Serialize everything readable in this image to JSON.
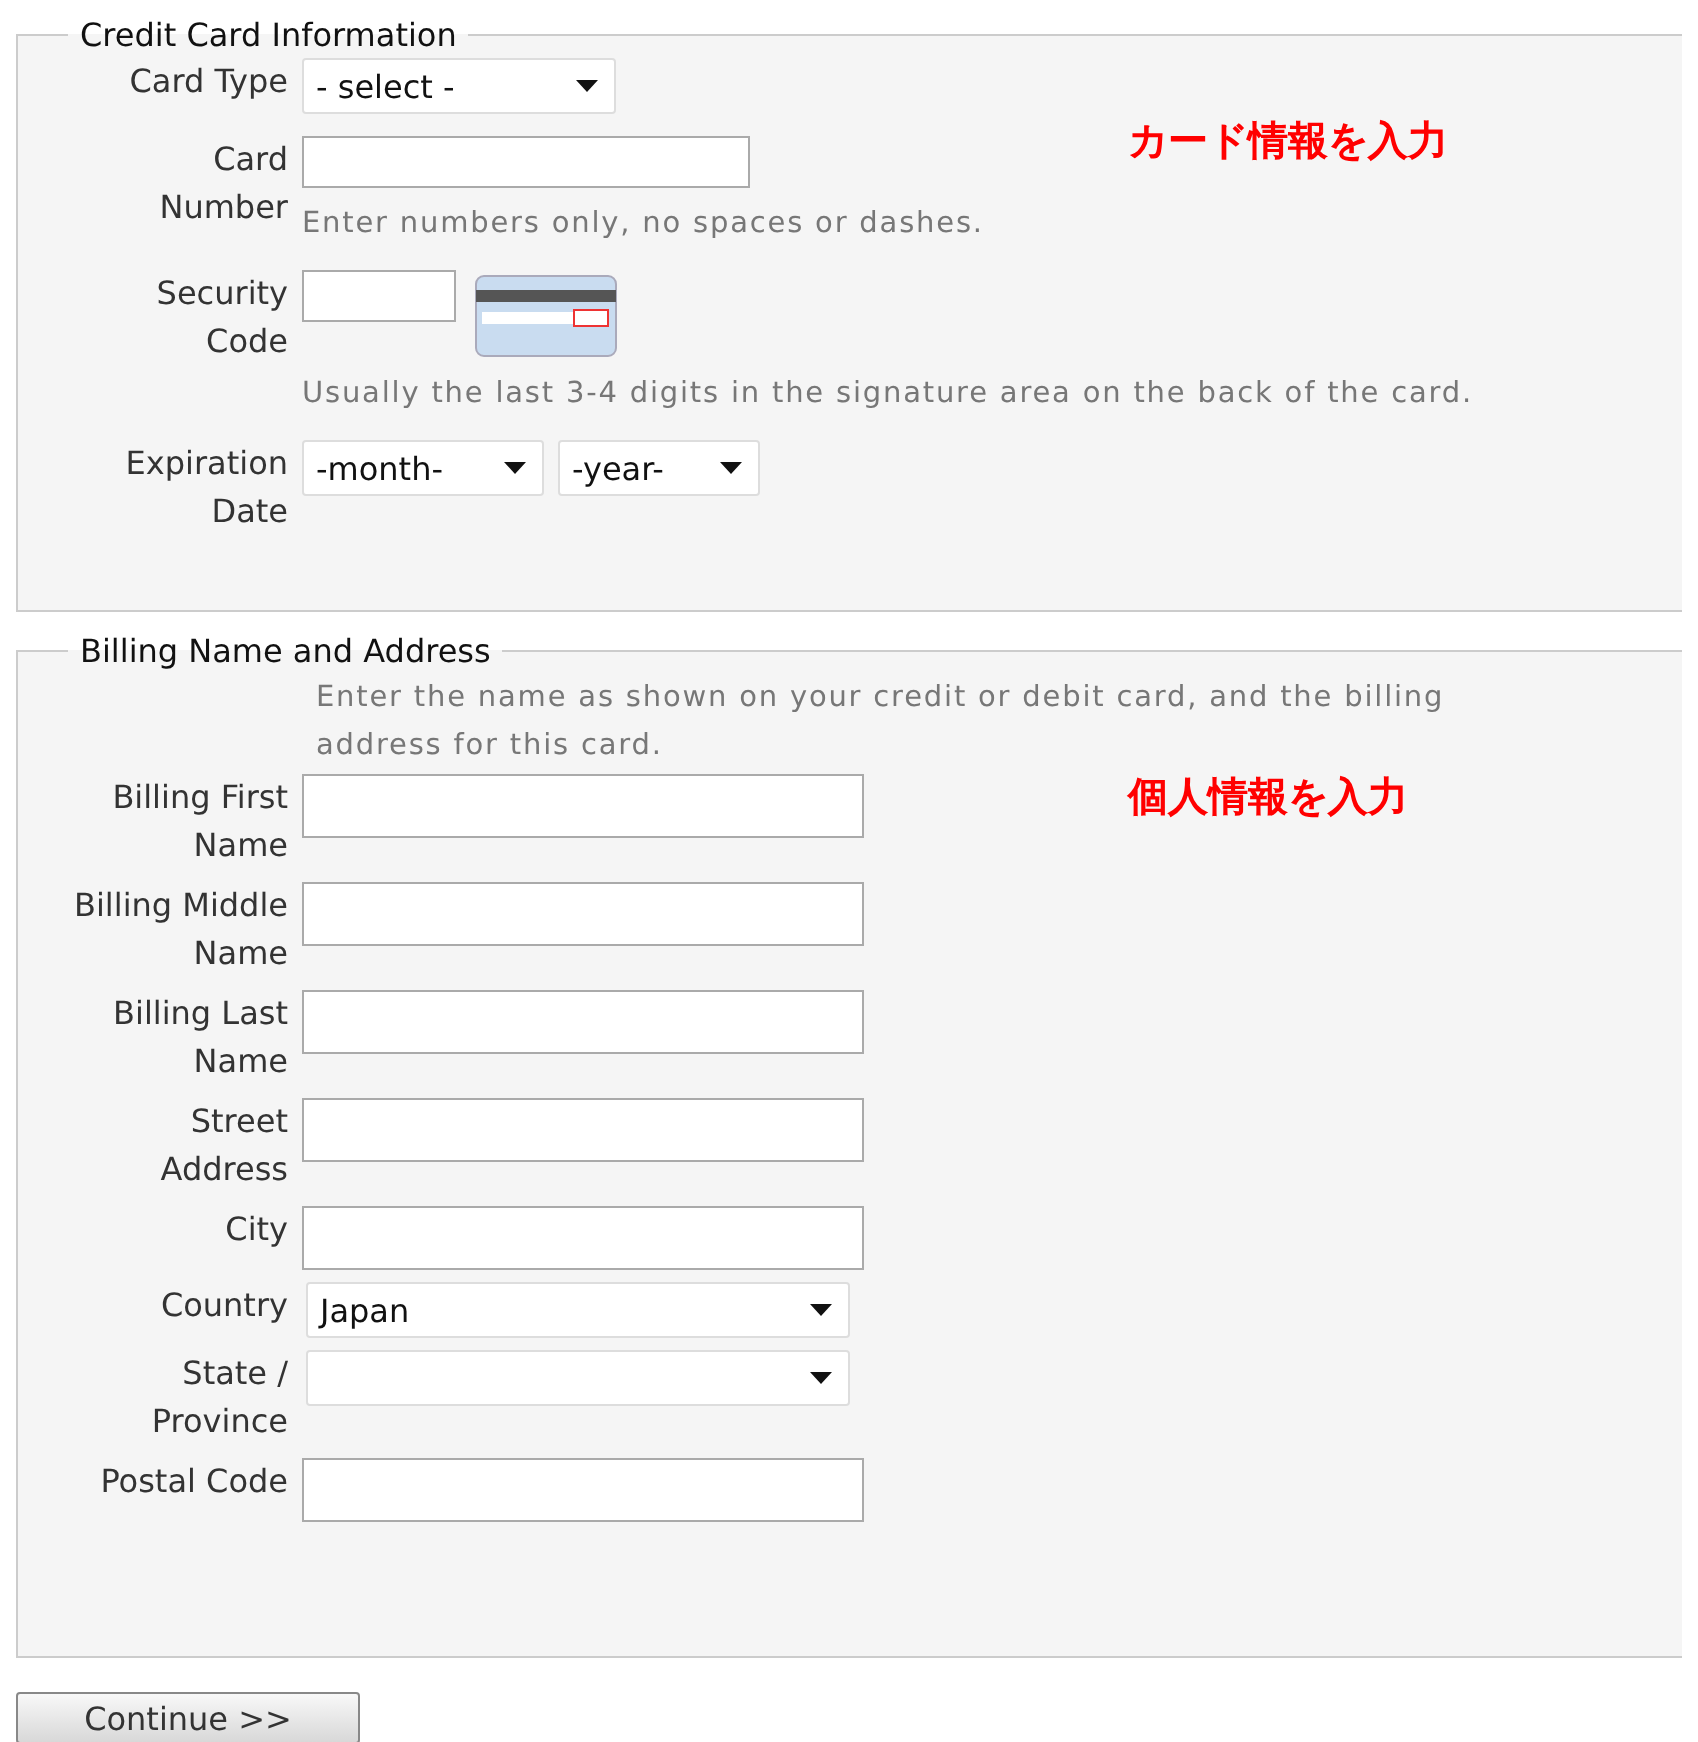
{
  "credit_card": {
    "legend": "Credit Card Information",
    "annotation": "カード情報を入力",
    "fields": [
      {
        "kind": "select",
        "label": "Card Type",
        "value": "- select -"
      },
      {
        "kind": "text",
        "label": "Card\nNumber",
        "hint": "Enter numbers only, no spaces or dashes."
      },
      {
        "kind": "security",
        "label": "Security\nCode",
        "hint": "Usually the last 3-4 digits in the signature area on the back of the card."
      },
      {
        "kind": "date",
        "label": "Expiration\nDate",
        "selects": [
          "-month-",
          "-year-"
        ]
      }
    ]
  },
  "billing": {
    "legend": "Billing Name and Address",
    "intro": "Enter the name as shown on your credit or debit card, and the billing address for this card.",
    "annotation": "個人情報を入力",
    "fields": [
      {
        "kind": "text",
        "label": "Billing First\nName"
      },
      {
        "kind": "text",
        "label": "Billing Middle\nName"
      },
      {
        "kind": "text",
        "label": "Billing Last\nName"
      },
      {
        "kind": "text",
        "label": "Street\nAddress"
      },
      {
        "kind": "text",
        "label": "City"
      },
      {
        "kind": "select",
        "label": "Country",
        "value": "Japan"
      },
      {
        "kind": "select",
        "label": "State /\nProvince"
      },
      {
        "kind": "text",
        "label": "Postal Code"
      }
    ]
  },
  "continue_button": "Continue >>"
}
